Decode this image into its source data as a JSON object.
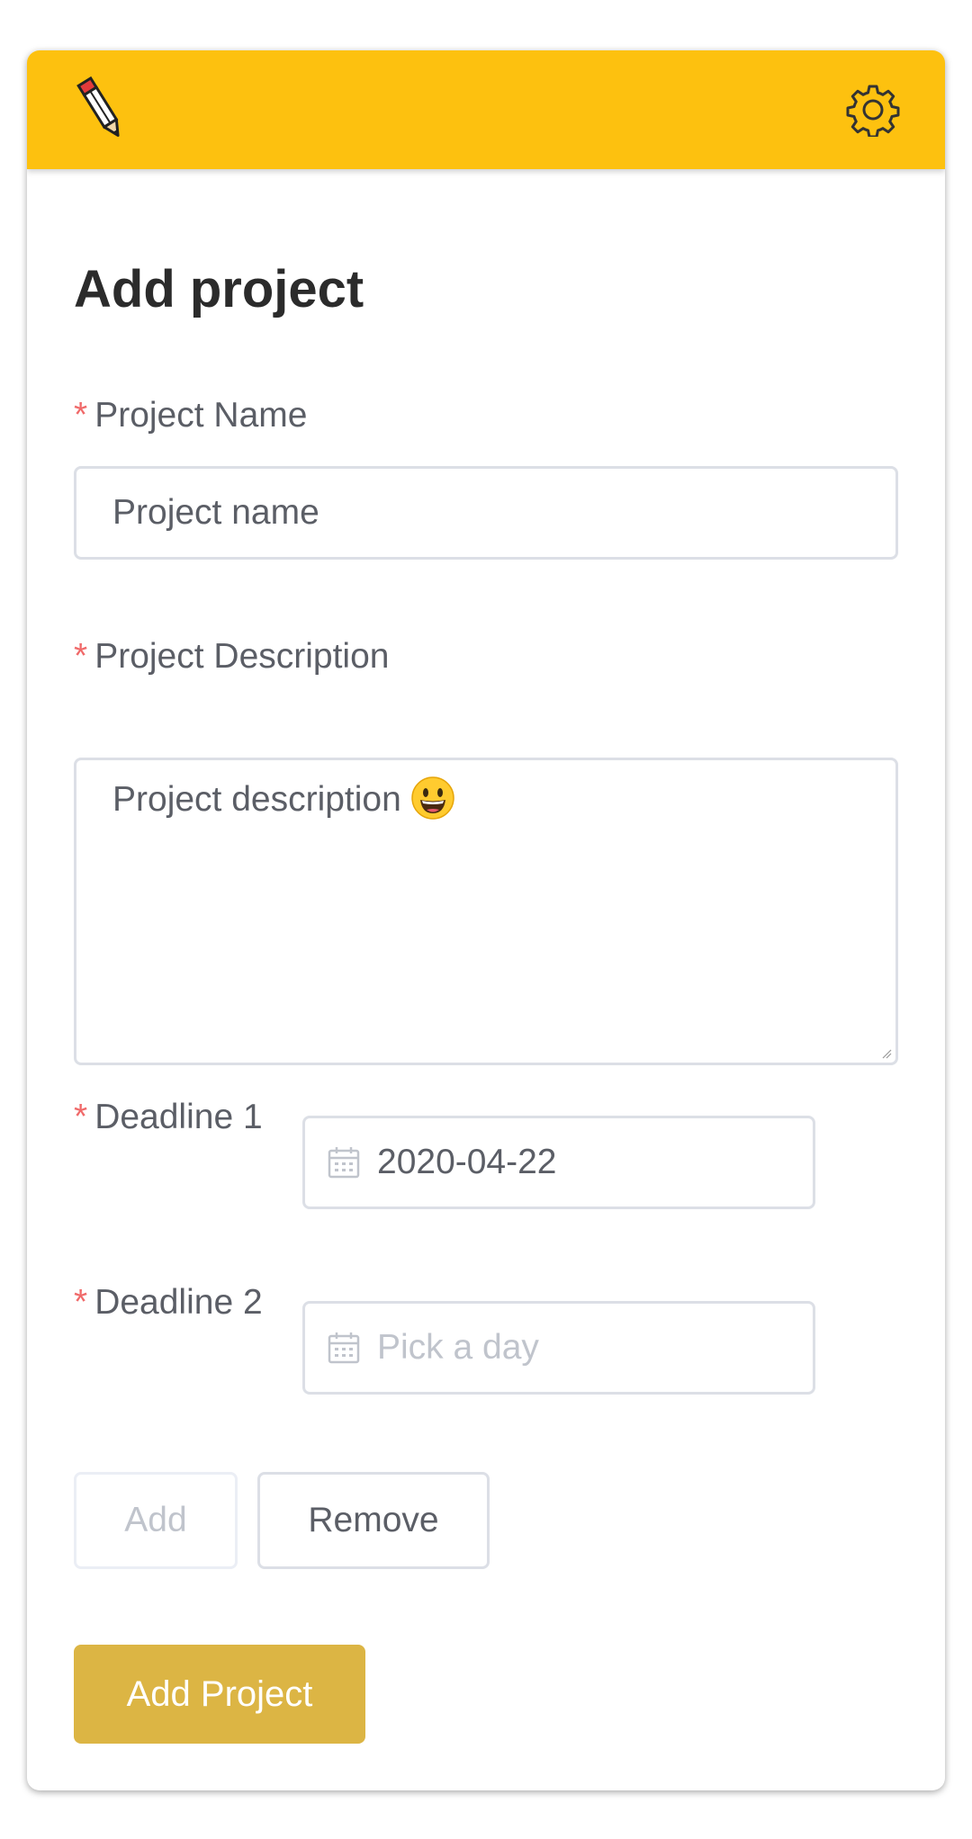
{
  "colors": {
    "header": "#fdc10f",
    "primary_button": "#dcb544",
    "required_mark": "#f06a6a",
    "text": "#5b5e66",
    "placeholder": "#c0c4cc",
    "border": "#dcdfe6"
  },
  "header": {
    "logo_icon": "pencil-icon",
    "settings_icon": "gear-icon"
  },
  "form": {
    "title": "Add project",
    "required_mark": "*",
    "name": {
      "label": "Project Name",
      "placeholder": "Project name",
      "value": ""
    },
    "description": {
      "label": "Project Description",
      "placeholder": "Project description",
      "emoji_icon": "smiley-face-icon",
      "value": ""
    },
    "deadline1": {
      "label": "Deadline 1",
      "value": "2020-04-22",
      "icon": "calendar-icon"
    },
    "deadline2": {
      "label": "Deadline 2",
      "placeholder": "Pick a day",
      "icon": "calendar-icon"
    },
    "buttons": {
      "add": "Add",
      "remove": "Remove",
      "submit": "Add Project"
    }
  }
}
